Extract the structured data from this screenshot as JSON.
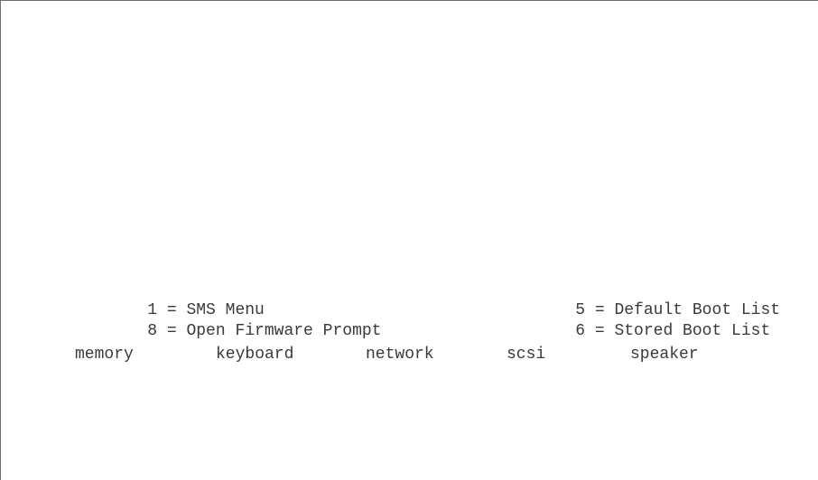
{
  "menu": {
    "left": [
      {
        "key": "1",
        "label": "SMS Menu"
      },
      {
        "key": "8",
        "label": "Open Firmware Prompt"
      }
    ],
    "right": [
      {
        "key": "5",
        "label": "Default Boot List"
      },
      {
        "key": "6",
        "label": "Stored Boot List"
      }
    ]
  },
  "devices": [
    "memory",
    "keyboard",
    "network",
    "scsi",
    "speaker"
  ]
}
